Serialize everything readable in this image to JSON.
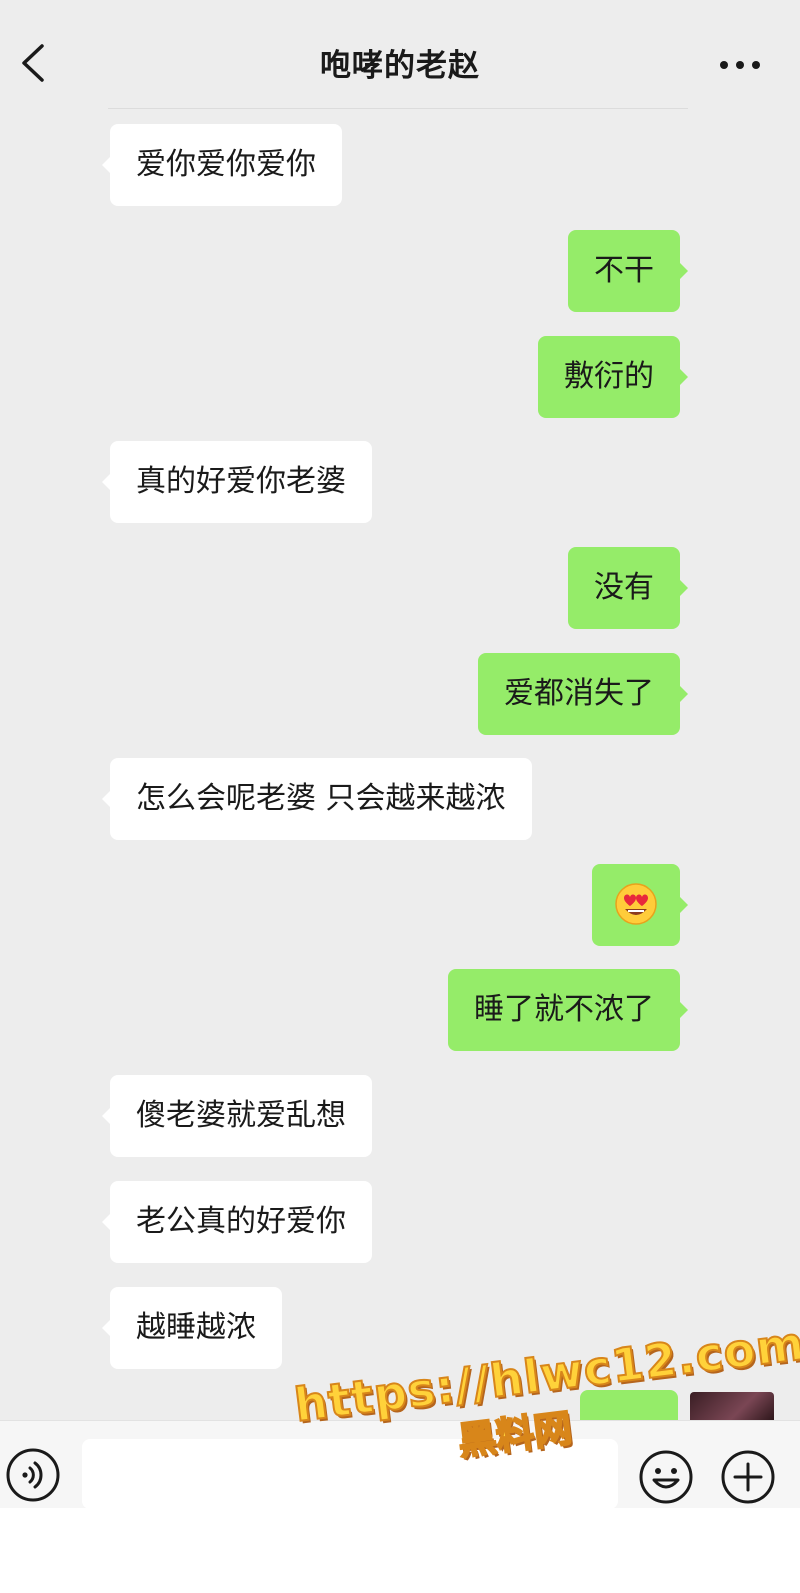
{
  "header": {
    "title": "咆哮的老赵"
  },
  "messages": [
    {
      "dir": "in",
      "text": "爱你爱你爱你"
    },
    {
      "dir": "out",
      "text": "不干"
    },
    {
      "dir": "out",
      "text": "敷衍的"
    },
    {
      "dir": "in",
      "text": "真的好爱你老婆"
    },
    {
      "dir": "out",
      "text": "没有"
    },
    {
      "dir": "out",
      "text": "爱都消失了"
    },
    {
      "dir": "in",
      "text": "怎么会呢老婆 只会越来越浓"
    },
    {
      "dir": "out",
      "emoji": "heart-eyes-emoji"
    },
    {
      "dir": "out",
      "text": "睡了就不浓了"
    },
    {
      "dir": "in",
      "text": "傻老婆就爱乱想"
    },
    {
      "dir": "in",
      "text": "老公真的好爱你"
    },
    {
      "dir": "in",
      "text": "越睡越浓"
    }
  ],
  "watermark": {
    "line1": "https://hlwc12.com",
    "line2": "黑料网"
  },
  "icons": {
    "back": "back-chevron-icon",
    "more": "more-dots-icon",
    "voice": "voice-icon",
    "emoji": "smile-emoji-icon",
    "plus": "plus-icon"
  },
  "colors": {
    "background": "#ededed",
    "outgoing_bubble": "#95ec69",
    "incoming_bubble": "#ffffff"
  }
}
